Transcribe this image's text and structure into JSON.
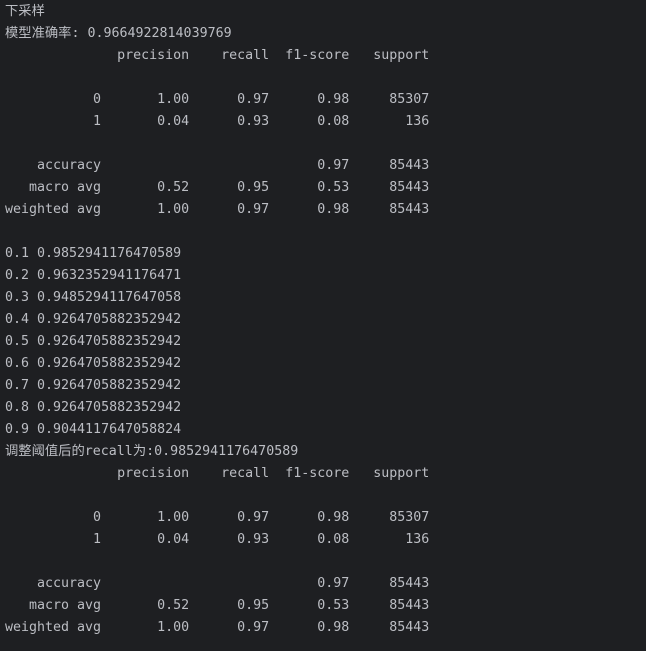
{
  "console": {
    "lines": [
      "下采样",
      "模型准确率: 0.9664922814039769",
      "              precision    recall  f1-score   support",
      "",
      "           0       1.00      0.97      0.98     85307",
      "           1       0.04      0.93      0.08       136",
      "",
      "    accuracy                           0.97     85443",
      "   macro avg       0.52      0.95      0.53     85443",
      "weighted avg       1.00      0.97      0.98     85443",
      "",
      "0.1 0.9852941176470589",
      "0.2 0.9632352941176471",
      "0.3 0.9485294117647058",
      "0.4 0.9264705882352942",
      "0.5 0.9264705882352942",
      "0.6 0.9264705882352942",
      "0.7 0.9264705882352942",
      "0.8 0.9264705882352942",
      "0.9 0.9044117647058824",
      "调整阈值后的recall为:0.9852941176470589",
      "              precision    recall  f1-score   support",
      "",
      "           0       1.00      0.97      0.98     85307",
      "           1       0.04      0.93      0.08       136",
      "",
      "    accuracy                           0.97     85443",
      "   macro avg       0.52      0.95      0.53     85443",
      "weighted avg       1.00      0.97      0.98     85443"
    ]
  }
}
